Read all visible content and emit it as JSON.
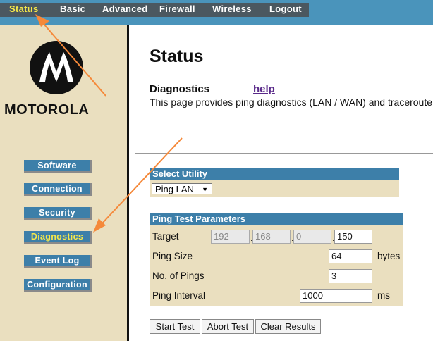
{
  "topnav": {
    "items": [
      "Status",
      "Basic",
      "Advanced",
      "Firewall",
      "Wireless",
      "Logout"
    ]
  },
  "brand": {
    "name": "MOTOROLA"
  },
  "sidebar": {
    "items": [
      "Software",
      "Connection",
      "Security",
      "Diagnostics",
      "Event Log",
      "Configuration"
    ]
  },
  "page": {
    "title": "Status",
    "section": "Diagnostics",
    "help": "help",
    "description": "This page provides ping diagnostics (LAN / WAN) and traceroute"
  },
  "utility": {
    "header": "Select Utility",
    "selected": "Ping LAN"
  },
  "ping": {
    "header": "Ping Test Parameters",
    "target_label": "Target",
    "target": [
      "192",
      "168",
      "0",
      "150"
    ],
    "size_label": "Ping Size",
    "size": "64",
    "size_unit": "bytes",
    "count_label": "No. of Pings",
    "count": "3",
    "interval_label": "Ping Interval",
    "interval": "1000",
    "interval_unit": "ms"
  },
  "actions": {
    "start": "Start Test",
    "abort": "Abort Test",
    "clear": "Clear Results"
  },
  "colors": {
    "nav_blue": "#4a94bb",
    "button_blue": "#3d7fa9",
    "sidebar_beige": "#eadfbf",
    "active_yellow": "#f5e84a",
    "annotation_arrow": "#f5893a"
  }
}
